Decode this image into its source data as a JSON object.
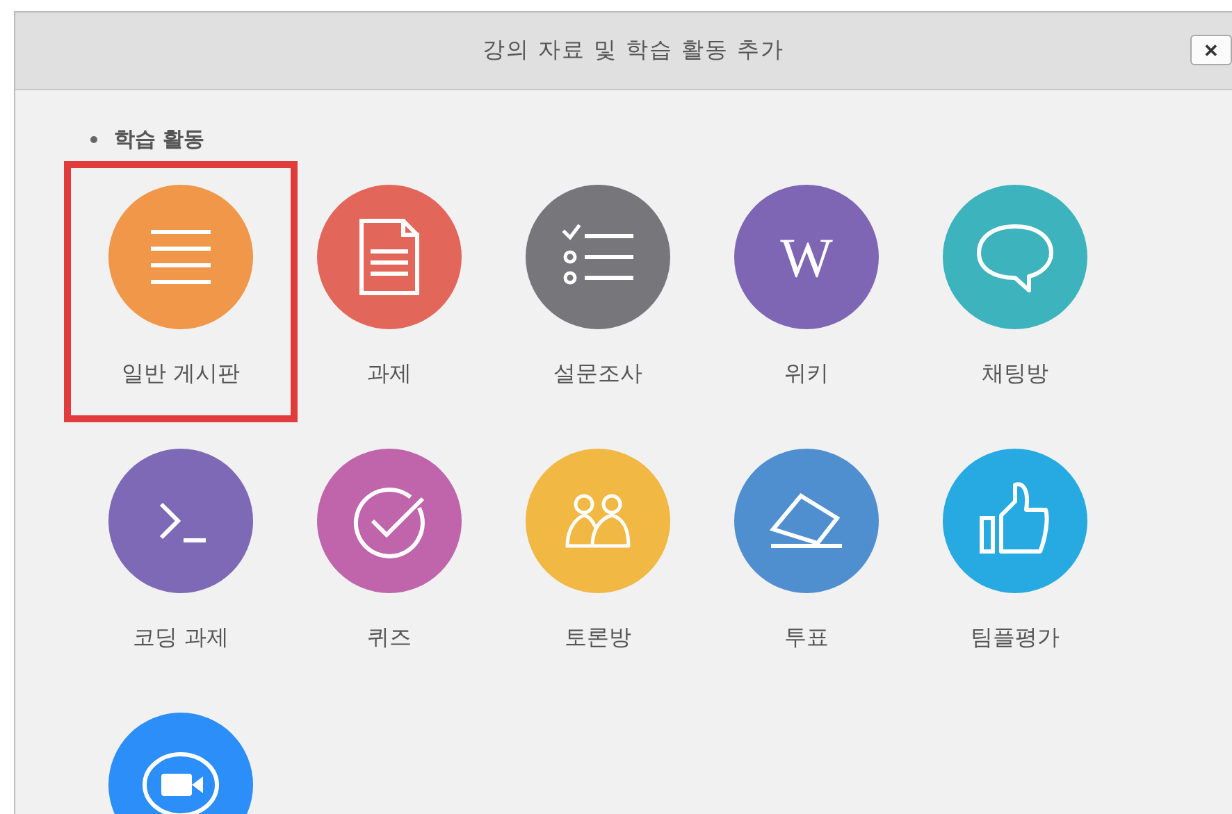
{
  "dialog": {
    "title": "강의 자료 및 학습 활동 추가",
    "close": "✕"
  },
  "section": {
    "heading": "학습 활동"
  },
  "items": [
    {
      "kind": "list",
      "color": "#f0974a",
      "label": "일반 게시판",
      "highlighted": true
    },
    {
      "kind": "document",
      "color": "#e3665a",
      "label": "과제",
      "highlighted": false
    },
    {
      "kind": "checklist",
      "color": "#77777b",
      "label": "설문조사",
      "highlighted": false
    },
    {
      "kind": "letter",
      "glyph": "W",
      "color": "#7f66b5",
      "label": "위키",
      "highlighted": false
    },
    {
      "kind": "chat",
      "color": "#3db3bd",
      "label": "채팅방",
      "highlighted": false
    },
    {
      "kind": "terminal",
      "color": "#7d69b6",
      "label": "코딩 과제",
      "highlighted": false
    },
    {
      "kind": "check",
      "color": "#c064ab",
      "label": "퀴즈",
      "highlighted": false
    },
    {
      "kind": "people",
      "color": "#f1b843",
      "label": "토론방",
      "highlighted": false
    },
    {
      "kind": "eraser",
      "color": "#4f8fd0",
      "label": "투표",
      "highlighted": false
    },
    {
      "kind": "thumb",
      "color": "#27a9e1",
      "label": "팀플평가",
      "highlighted": false
    },
    {
      "kind": "video",
      "color": "#2b8ef9",
      "highlighted": false
    }
  ]
}
